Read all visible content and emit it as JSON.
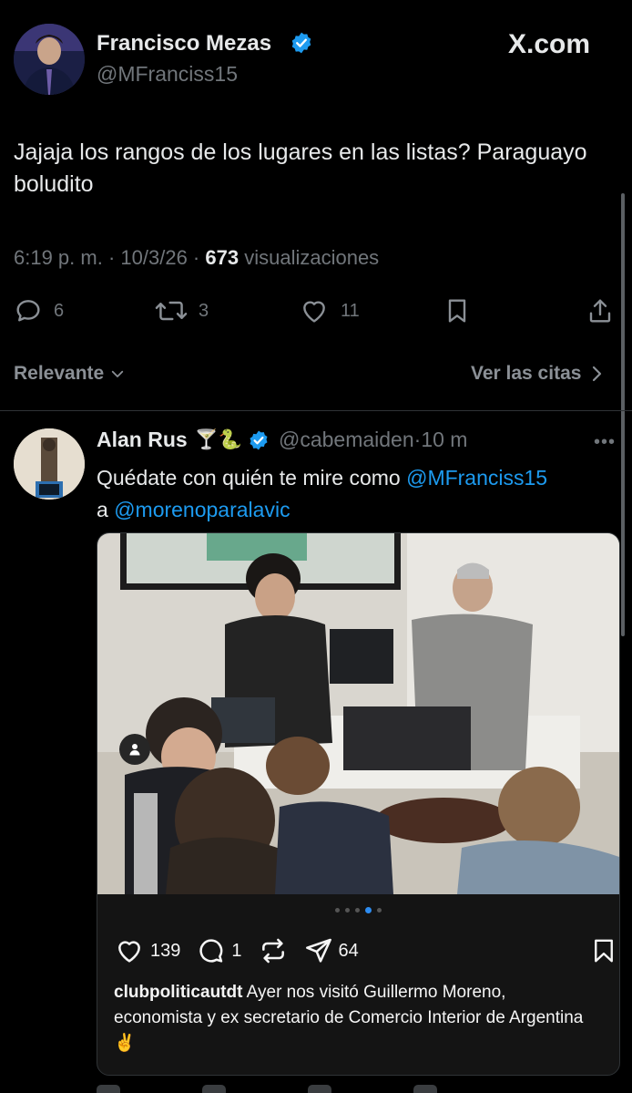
{
  "tweet": {
    "author_name": "Francisco Mezas",
    "author_handle": "@MFranciss15",
    "brand": "X.com",
    "text": "Jajaja los rangos de los lugares en las listas? Paraguayo boludito",
    "time": "6:19 p. m.",
    "date": "10/3/26",
    "views_count": "673",
    "views_label": "visualizaciones",
    "actions": {
      "replies": "6",
      "reposts": "3",
      "likes": "11"
    }
  },
  "sort": {
    "label": "Relevante",
    "quotes_label": "Ver las citas"
  },
  "reply": {
    "author_name": "Alan Rus",
    "emojis": "🍸🐍",
    "author_handle": "@cabemaiden",
    "time": "10 m",
    "text_before": "Quédate con quién te mire como ",
    "mention_1": "@MFranciss15",
    "text_middle": "a ",
    "mention_2": "@morenoparalavic"
  },
  "instagram": {
    "likes": "139",
    "comments": "1",
    "shares": "64",
    "carousel_total": 5,
    "carousel_active": 4,
    "caption_user": "clubpoliticautdt",
    "caption_text": "Ayer nos visitó Guillermo Moreno, economista y ex secretario de Comercio Interior de Argentina ✌️"
  },
  "colors": {
    "accent": "#1d9bf0",
    "muted": "#71767b",
    "background": "#000000"
  }
}
